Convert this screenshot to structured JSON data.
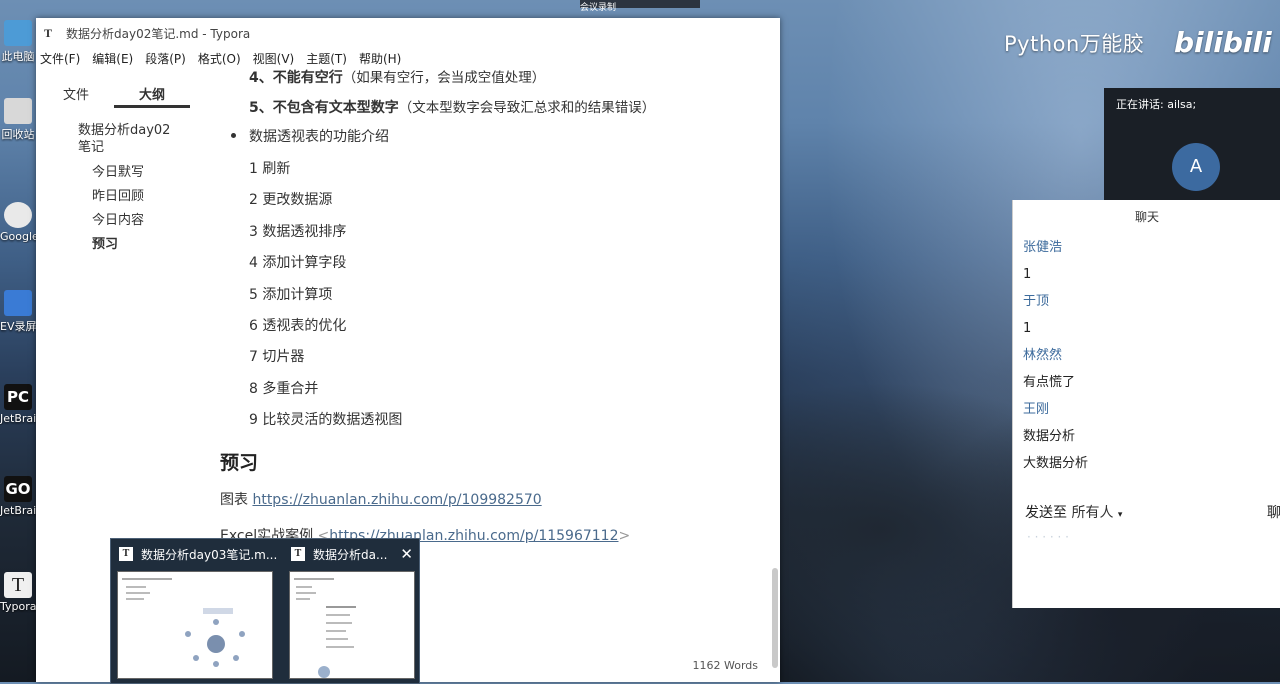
{
  "desktop": {
    "icons": [
      {
        "label": "此电脑",
        "color": "#4d9bd6"
      },
      {
        "label": "回收站",
        "color": "#d8d8d8"
      },
      {
        "label": "Google Chrome",
        "color": "#e9e9e9"
      },
      {
        "label": "EV录屏",
        "color": "#3a7bd5"
      },
      {
        "label": "JetBrains PyCharm",
        "color": "#111"
      },
      {
        "label": "JetBrains GoLand",
        "color": "#111"
      },
      {
        "label": "Typora",
        "color": "#f0f0f0"
      }
    ],
    "pc_text": "PC",
    "go_text": "GO",
    "ty_text": "T"
  },
  "top_strip": {
    "label": "会议录制"
  },
  "typora": {
    "title": "数据分析day02笔记.md - Typora",
    "menu": [
      "文件(F)",
      "编辑(E)",
      "段落(P)",
      "格式(O)",
      "视图(V)",
      "主题(T)",
      "帮助(H)"
    ],
    "sidebar": {
      "tabs": [
        "文件",
        "大纲"
      ],
      "outline_root": "数据分析day02笔记",
      "outline_items": [
        "今日默写",
        "昨日回顾",
        "今日内容",
        "预习"
      ]
    },
    "content": {
      "rule4_prefix": "4、不能有空行",
      "rule4_note": "（如果有空行，会当成空值处理）",
      "rule5_prefix": "5、不包含有文本型数字",
      "rule5_note": "（文本型数字会导致汇总求和的结果错误）",
      "bullet": "数据透视表的功能介绍",
      "features": [
        "1 刷新",
        "2 更改数据源",
        "3 数据透视排序",
        "4 添加计算字段",
        "5 添加计算项",
        "6 透视表的优化",
        "7 切片器",
        "8 多重合并",
        "9 比较灵活的数据透视图"
      ],
      "heading": "预习",
      "chart_label": "图表",
      "chart_link": "https://zhuanlan.zhihu.com/p/109982570",
      "excel_label": "Excel实战案例",
      "excel_link": "https://zhuanlan.zhihu.com/p/115967112"
    },
    "word_count": "1162 Words"
  },
  "previews": [
    {
      "title": "数据分析day03笔记.m..."
    },
    {
      "title": "数据分析da..."
    }
  ],
  "brand": {
    "text": "Python万能胶",
    "logo": "bilibili"
  },
  "meeting": {
    "speaking": "正在讲话: ailsa;",
    "avatar": "A",
    "chat_title": "聊天",
    "messages": [
      {
        "name": "张健浩",
        "text": "1"
      },
      {
        "name": "于顶",
        "text": "1"
      },
      {
        "name": "林然然",
        "text": "有点慌了"
      },
      {
        "name": "王刚",
        "text": "数据分析"
      }
    ],
    "extra_line": "大数据分析",
    "send_to_label": "发送至",
    "send_to_value": "所有人",
    "right_cut": "聊"
  }
}
